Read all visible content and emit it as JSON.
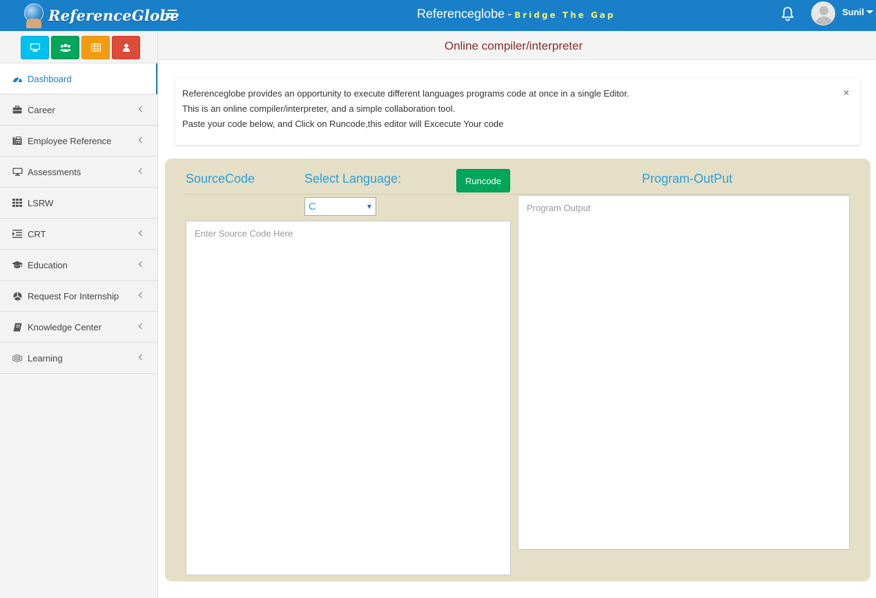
{
  "header": {
    "logo_text": "ReferenceGlobe",
    "brand_name": "Referenceglobe",
    "brand_separator": "-",
    "brand_tagline": "Bridge The Gap",
    "user_name": "Sunil",
    "color": "#1a7fc9"
  },
  "sidebar": {
    "quick_buttons": [
      {
        "icon": "monitor-icon",
        "color": "#00c0ef"
      },
      {
        "icon": "users-icon",
        "color": "#00a65a"
      },
      {
        "icon": "table-icon",
        "color": "#f39c12"
      },
      {
        "icon": "user-icon",
        "color": "#dd4b39"
      }
    ],
    "items": [
      {
        "label": "Dashboard",
        "icon": "dashboard-icon",
        "active": true
      },
      {
        "label": "Career",
        "icon": "briefcase-icon"
      },
      {
        "label": "Employee Reference",
        "icon": "fax-icon"
      },
      {
        "label": "Assessments",
        "icon": "desktop-icon"
      },
      {
        "label": "LSRW",
        "icon": "grid-icon"
      },
      {
        "label": "CRT",
        "icon": "indent-icon"
      },
      {
        "label": "Education",
        "icon": "graduation-cap-icon"
      },
      {
        "label": "Request For Internship",
        "icon": "pie-icon"
      },
      {
        "label": "Knowledge Center",
        "icon": "book-icon"
      },
      {
        "label": "Learning",
        "icon": "brain-icon"
      }
    ]
  },
  "page": {
    "title": "Online compiler/interpreter"
  },
  "alert": {
    "line1": "Referenceglobe provides an opportunity to execute different languages programs code at once in a single Editor.",
    "line2": "This is an online compiler/interpreter, and a simple collaboration tool.",
    "line3": "Paste your code below, and Click on Runcode,this editor will Excecute Your code",
    "close": "×"
  },
  "editor": {
    "source_label": "SourceCode",
    "language_label": "Select Language:",
    "run_label": "Runcode",
    "output_label": "Program-OutPut",
    "language_selected": "C",
    "source_placeholder": "Enter Source Code Here",
    "output_placeholder": "Program Output"
  }
}
